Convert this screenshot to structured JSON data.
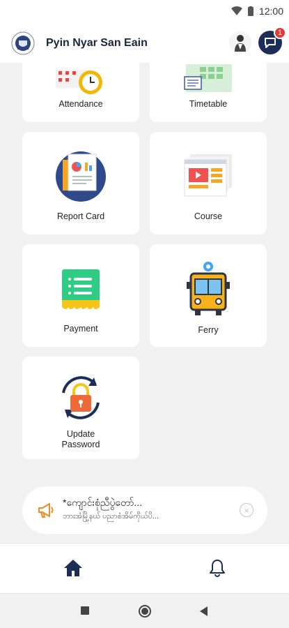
{
  "status": {
    "time": "12:00"
  },
  "app": {
    "title": "Pyin Nyar San Eain",
    "notification_count": "1"
  },
  "menu": {
    "attendance": "Attendance",
    "timetable": "Timetable",
    "report_card": "Report Card",
    "course": "Course",
    "payment": "Payment",
    "ferry": "Ferry",
    "update_password_line1": "Update",
    "update_password_line2": "Password"
  },
  "banner": {
    "title": "*ကျောင်းစုံညီပွဲတော်...",
    "subtitle": "ဘားအံမြို့နယ် ပညာစံအိမ်ကိုယ်ပိ..."
  },
  "colors": {
    "primary": "#1d2d58",
    "accent": "#e53935",
    "background": "#f1f1f1"
  }
}
